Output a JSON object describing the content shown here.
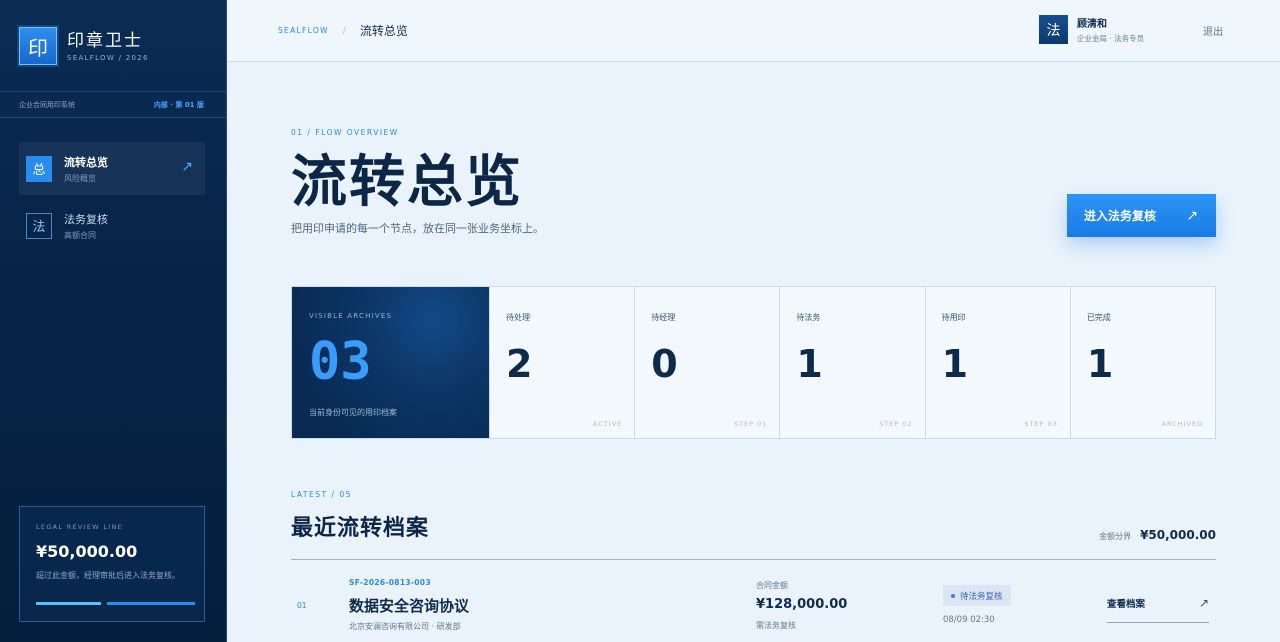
{
  "brand": {
    "mark": "印",
    "title": "印章卫士",
    "subtitle": "SEALFLOW / 2026"
  },
  "system": {
    "name": "企业合同用印系统",
    "tag": "内部 · 第 01 版"
  },
  "nav": [
    {
      "icon": "总",
      "label": "流转总览",
      "sub": "风险概览",
      "active": true,
      "arrow": "↗"
    },
    {
      "icon": "法",
      "label": "法务复核",
      "sub": "高额合同",
      "active": false
    }
  ],
  "legal": {
    "caption": "LEGAL REVIEW LINE",
    "amount": "¥50,000.00",
    "desc": "超过此金额，经理审批后进入法务复核。"
  },
  "topbar": {
    "root": "SEALFLOW",
    "sep": "/",
    "current": "流转总览"
  },
  "user": {
    "avatar": "法",
    "name": "顾清和",
    "role": "企业金局 · 法务专员",
    "logout": "退出"
  },
  "overview": {
    "caption": "01 / FLOW OVERVIEW",
    "title": "流转总览",
    "desc": "把用印申请的每一个节点，放在同一张业务坐标上。",
    "cta": {
      "label": "进入法务复核",
      "arrow": "↗"
    }
  },
  "stats": {
    "main": {
      "caption": "VISIBLE ARCHIVES",
      "value": "03",
      "desc": "当前身份可见的用印档案"
    },
    "items": [
      {
        "label": "待处理",
        "value": "2",
        "code": "ACTIVE"
      },
      {
        "label": "待经理",
        "value": "0",
        "code": "STEP 01"
      },
      {
        "label": "待法务",
        "value": "1",
        "code": "STEP 02"
      },
      {
        "label": "待用印",
        "value": "1",
        "code": "STEP 03"
      },
      {
        "label": "已完成",
        "value": "1",
        "code": "ARCHIVED"
      }
    ]
  },
  "latest": {
    "caption": "LATEST / 05",
    "title": "最近流转档案",
    "threshold_label": "金额分界",
    "threshold_value": "¥50,000.00"
  },
  "rows": [
    {
      "index": "01",
      "code": "SF-2026-0813-003",
      "name": "数据安全咨询协议",
      "org": "北京安澜咨询有限公司 · 研发部",
      "amount_caption": "合同金额",
      "amount": "¥128,000.00",
      "amount_note": "需法务复核",
      "status": "待法务复核",
      "time": "08/09 02:30",
      "link": "查看档案",
      "link_arrow": "↗"
    }
  ],
  "colors": {
    "accent": "#2d8ae6",
    "sidebar": "#072447",
    "bar_light": "#56c2ff",
    "bar_blue": "#2a8cf0"
  }
}
